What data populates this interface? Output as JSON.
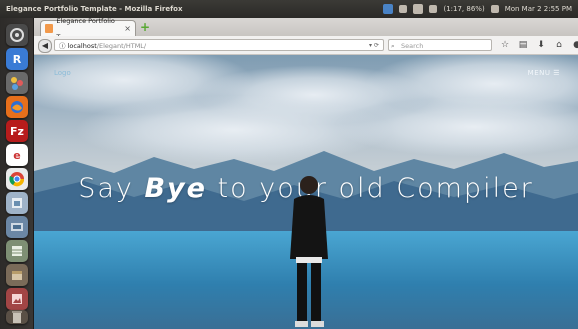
{
  "system": {
    "window_title": "Elegance Portfolio Template - Mozilla Firefox",
    "tray_status": "(1:17, 86%)",
    "clock": "Mon Mar 2 2:55 PM"
  },
  "browser": {
    "tab_title": "Elegance Portfolio T...",
    "tab_close": "×",
    "newtab": "+",
    "url_host": "localhost",
    "url_path": "/Elegant/HTML/",
    "search_placeholder": "Search"
  },
  "site": {
    "logo": "Logo",
    "menu": "MENU",
    "hero_before": "Say ",
    "hero_em": "Bye",
    "hero_after": " to your old Compiler"
  },
  "colors": {
    "accent_orange": "#f2994a",
    "launcher_bg": "#2d2b29",
    "topbar_bg": "#3b3a36"
  }
}
